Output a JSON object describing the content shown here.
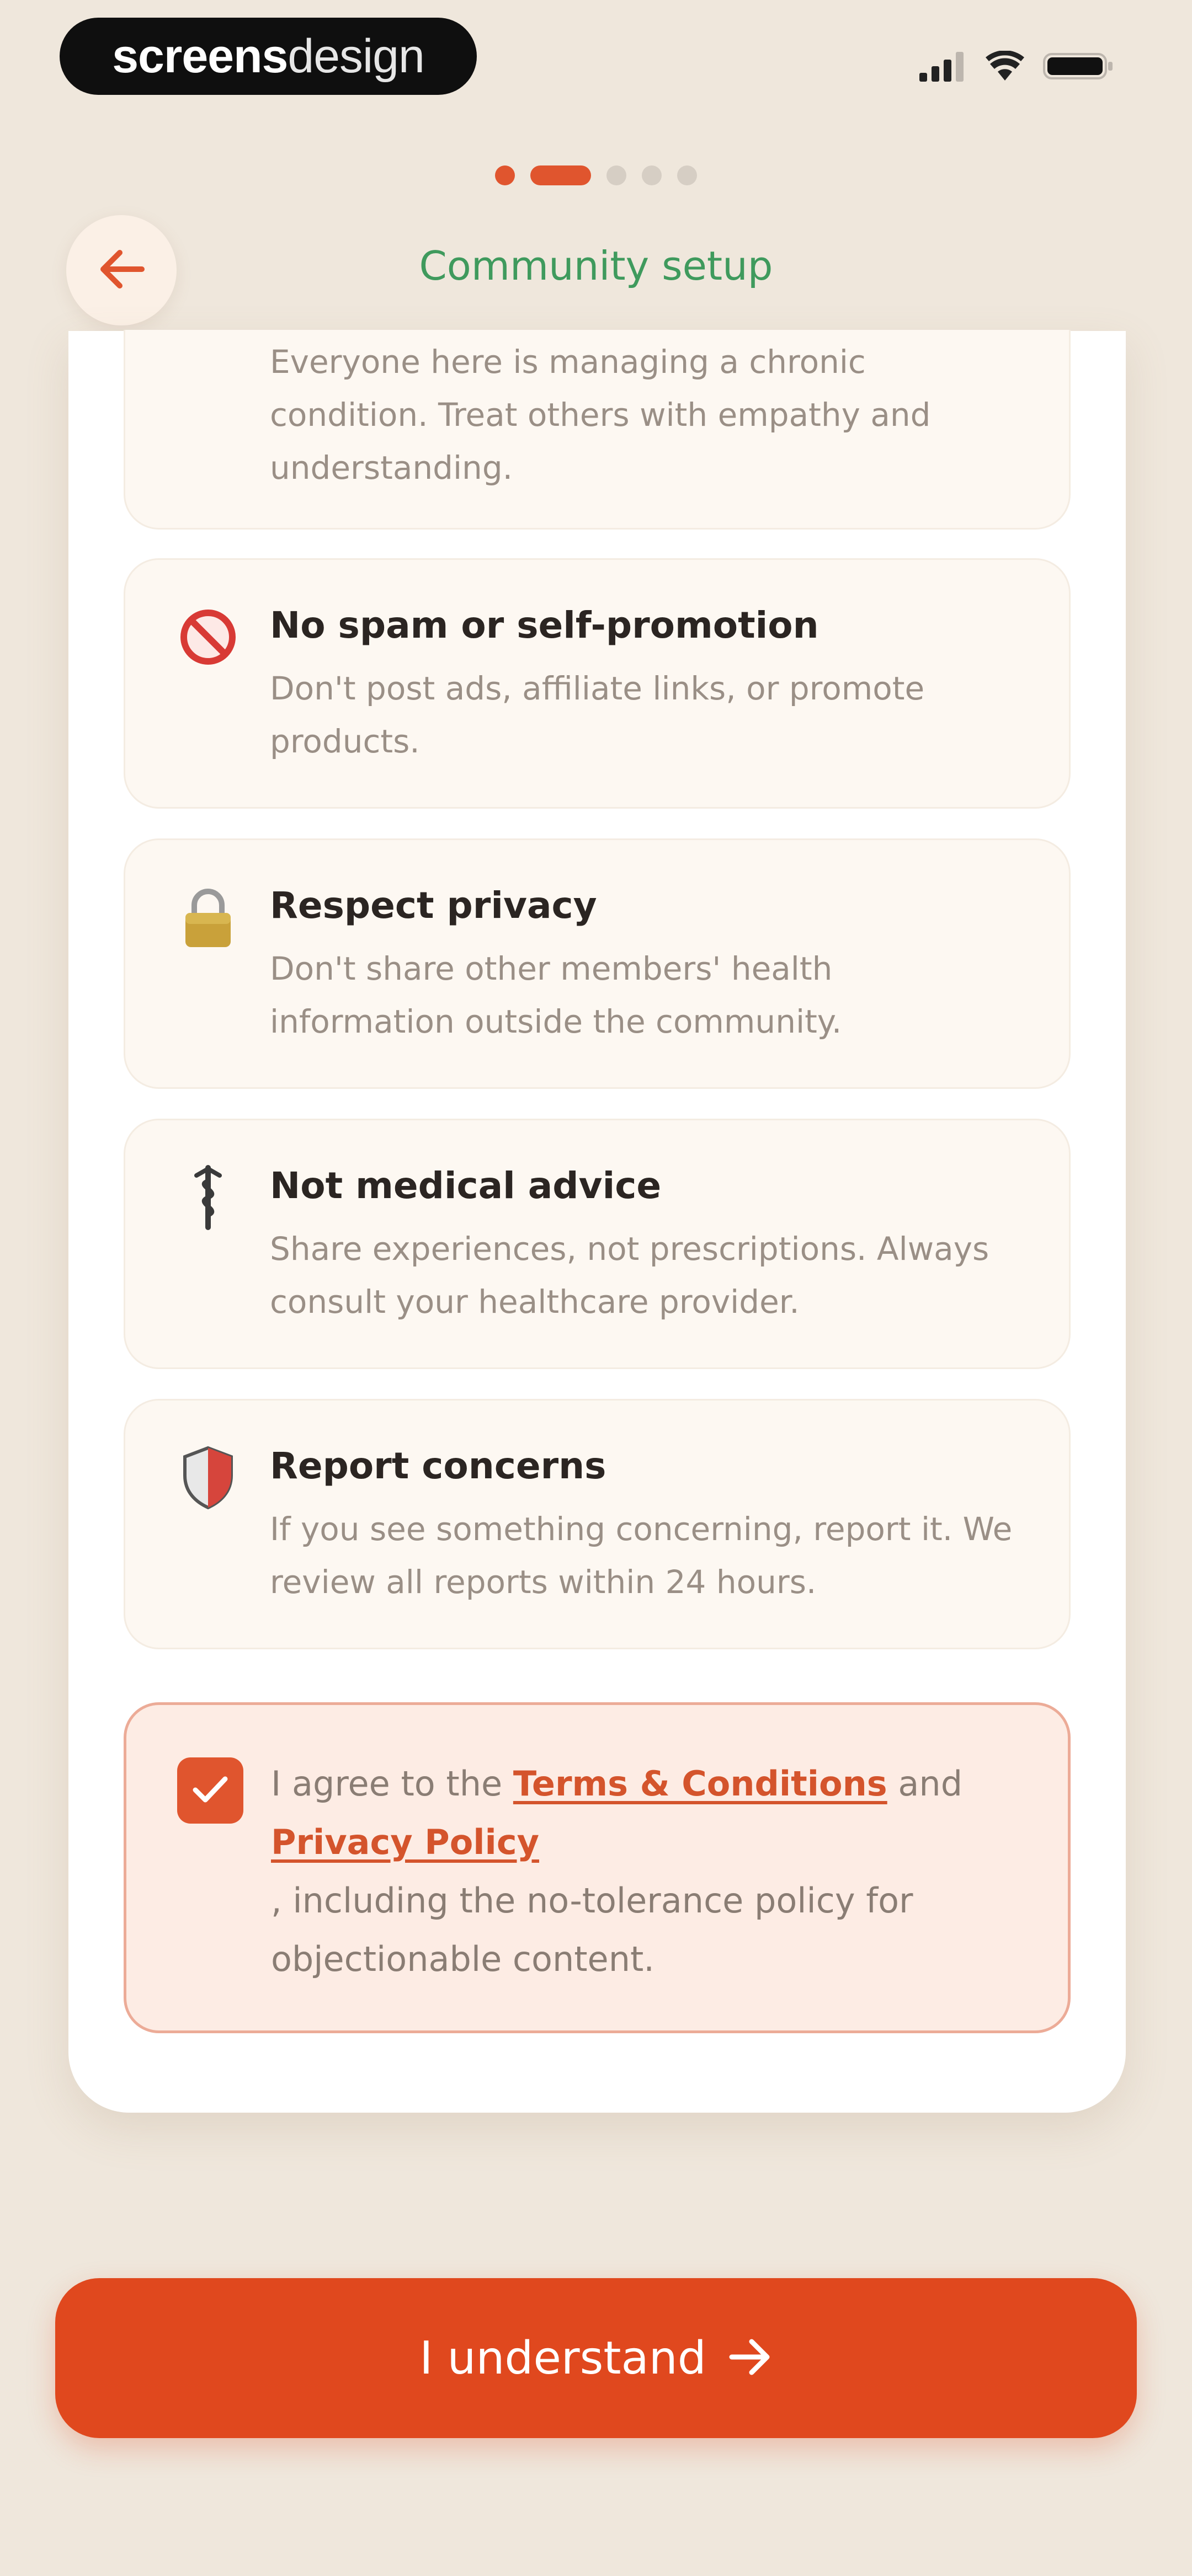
{
  "status_bar": {
    "brand_bold": "screens",
    "brand_thin": "design",
    "signal_icon": "signal-icon",
    "wifi_icon": "wifi-icon",
    "battery_icon": "battery-icon"
  },
  "progress": {
    "total_steps": 5,
    "current_step": 2
  },
  "header": {
    "back_icon": "arrow-left-icon",
    "title": "Community setup"
  },
  "rules": [
    {
      "icon": "heart-icon",
      "title": "",
      "description": "Everyone here is managing a chronic condition. Treat others with empathy and understanding."
    },
    {
      "icon": "prohibited-icon",
      "title": "No spam or self-promotion",
      "description": "Don't post ads, affiliate links, or promote products."
    },
    {
      "icon": "lock-icon",
      "title": "Respect privacy",
      "description": "Don't share other members' health information outside the community."
    },
    {
      "icon": "medical-staff-icon",
      "title": "Not medical advice",
      "description": "Share experiences, not prescriptions. Always consult your healthcare provider."
    },
    {
      "icon": "shield-icon",
      "title": "Report concerns",
      "description": "If you see something concerning, report it. We review all reports within 24 hours."
    }
  ],
  "agreement": {
    "checked": true,
    "prefix": "I agree to the ",
    "terms_link": "Terms & Conditions",
    "middle": " and ",
    "privacy_link": "Privacy Policy",
    "suffix": ", including the no-tolerance policy for objectionable content."
  },
  "cta": {
    "label": "I understand",
    "icon": "arrow-right-icon"
  },
  "colors": {
    "background": "#efe7dc",
    "accent": "#e0481e",
    "title_green": "#3f9a5d",
    "card": "#ffffff"
  }
}
